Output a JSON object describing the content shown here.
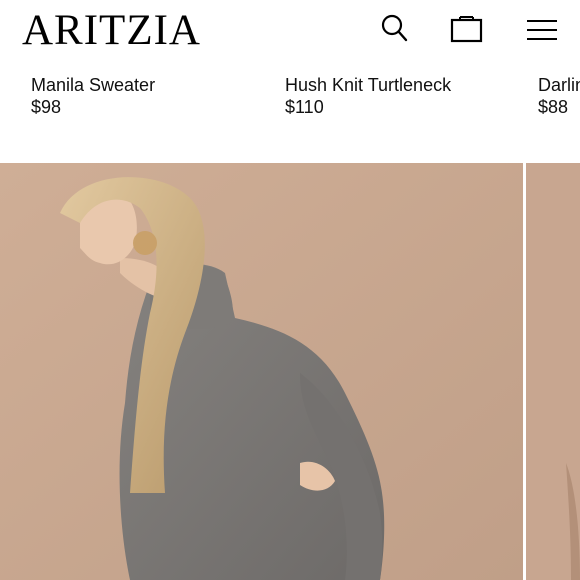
{
  "brand": {
    "logo_text": "ARITZIA"
  },
  "header": {
    "icons": [
      "search-icon",
      "shopping-bag-icon",
      "menu-icon"
    ]
  },
  "products": [
    {
      "name": "Manila Sweater",
      "price": "$98"
    },
    {
      "name": "Hush Knit Turtleneck",
      "price": "$110"
    },
    {
      "name": "Darlin",
      "price": "$88"
    }
  ],
  "colors": {
    "background": "#ffffff",
    "text": "#111111",
    "photo_backdrop": "#c8a890",
    "sweater": "#7a7876"
  }
}
